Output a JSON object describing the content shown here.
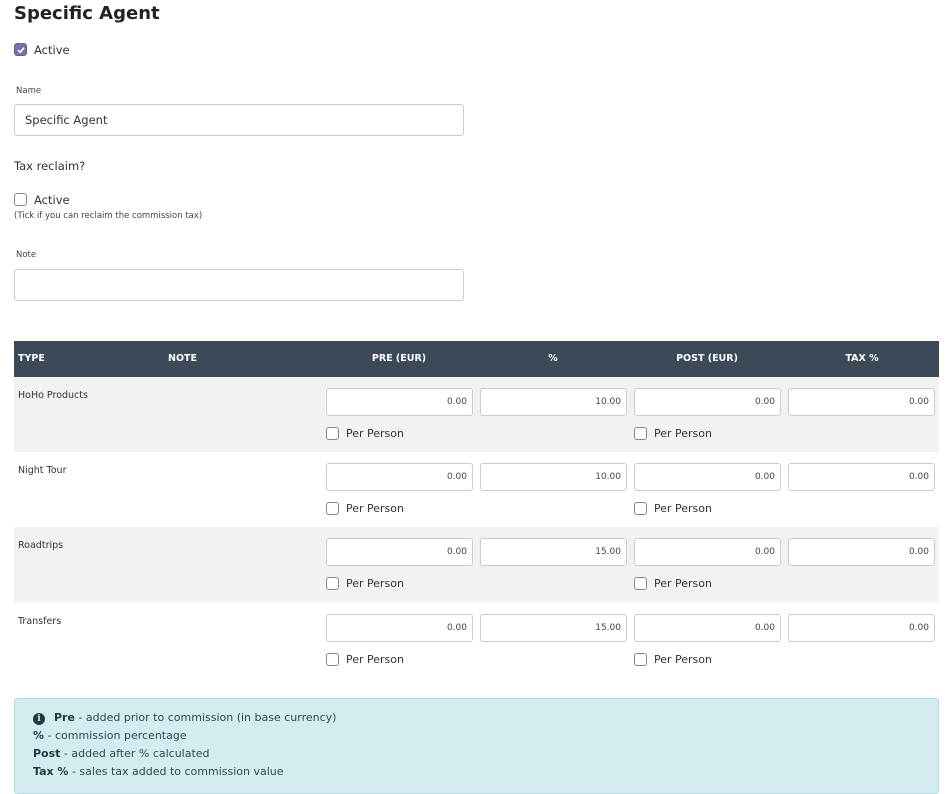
{
  "page": {
    "title": "Specific Agent"
  },
  "active": {
    "label": "Active",
    "checked": true
  },
  "name_field": {
    "label": "Name",
    "value": "Specific Agent"
  },
  "tax_reclaim": {
    "heading": "Tax reclaim?",
    "checkbox_label": "Active",
    "checked": false,
    "hint": "(Tick if you can reclaim the commission tax)"
  },
  "note_field": {
    "label": "Note",
    "value": ""
  },
  "table": {
    "headers": [
      "TYPE",
      "NOTE",
      "PRE (EUR)",
      "%",
      "POST (EUR)",
      "TAX %"
    ],
    "per_person_label": "Per Person",
    "rows": [
      {
        "type": "HoHo Products",
        "pre": "0.00",
        "percent": "10.00",
        "post": "0.00",
        "tax": "0.00"
      },
      {
        "type": "Night Tour",
        "pre": "0.00",
        "percent": "10.00",
        "post": "0.00",
        "tax": "0.00"
      },
      {
        "type": "Roadtrips",
        "pre": "0.00",
        "percent": "15.00",
        "post": "0.00",
        "tax": "0.00"
      },
      {
        "type": "Transfers",
        "pre": "0.00",
        "percent": "15.00",
        "post": "0.00",
        "tax": "0.00"
      }
    ]
  },
  "info": {
    "icon": "info-circle-icon",
    "lines": [
      {
        "term": "Pre",
        "desc": " - added prior to commission (in base currency)"
      },
      {
        "term": "%",
        "desc": " - commission percentage"
      },
      {
        "term": "Post",
        "desc": " - added after % calculated"
      },
      {
        "term": "Tax %",
        "desc": " - sales tax added to commission value"
      }
    ]
  },
  "colors": {
    "header_bg": "#3c4a57",
    "checkbox_accent": "#7f6fa8",
    "info_bg": "#d2ecf0",
    "row_shade": "#f2f2f2"
  }
}
